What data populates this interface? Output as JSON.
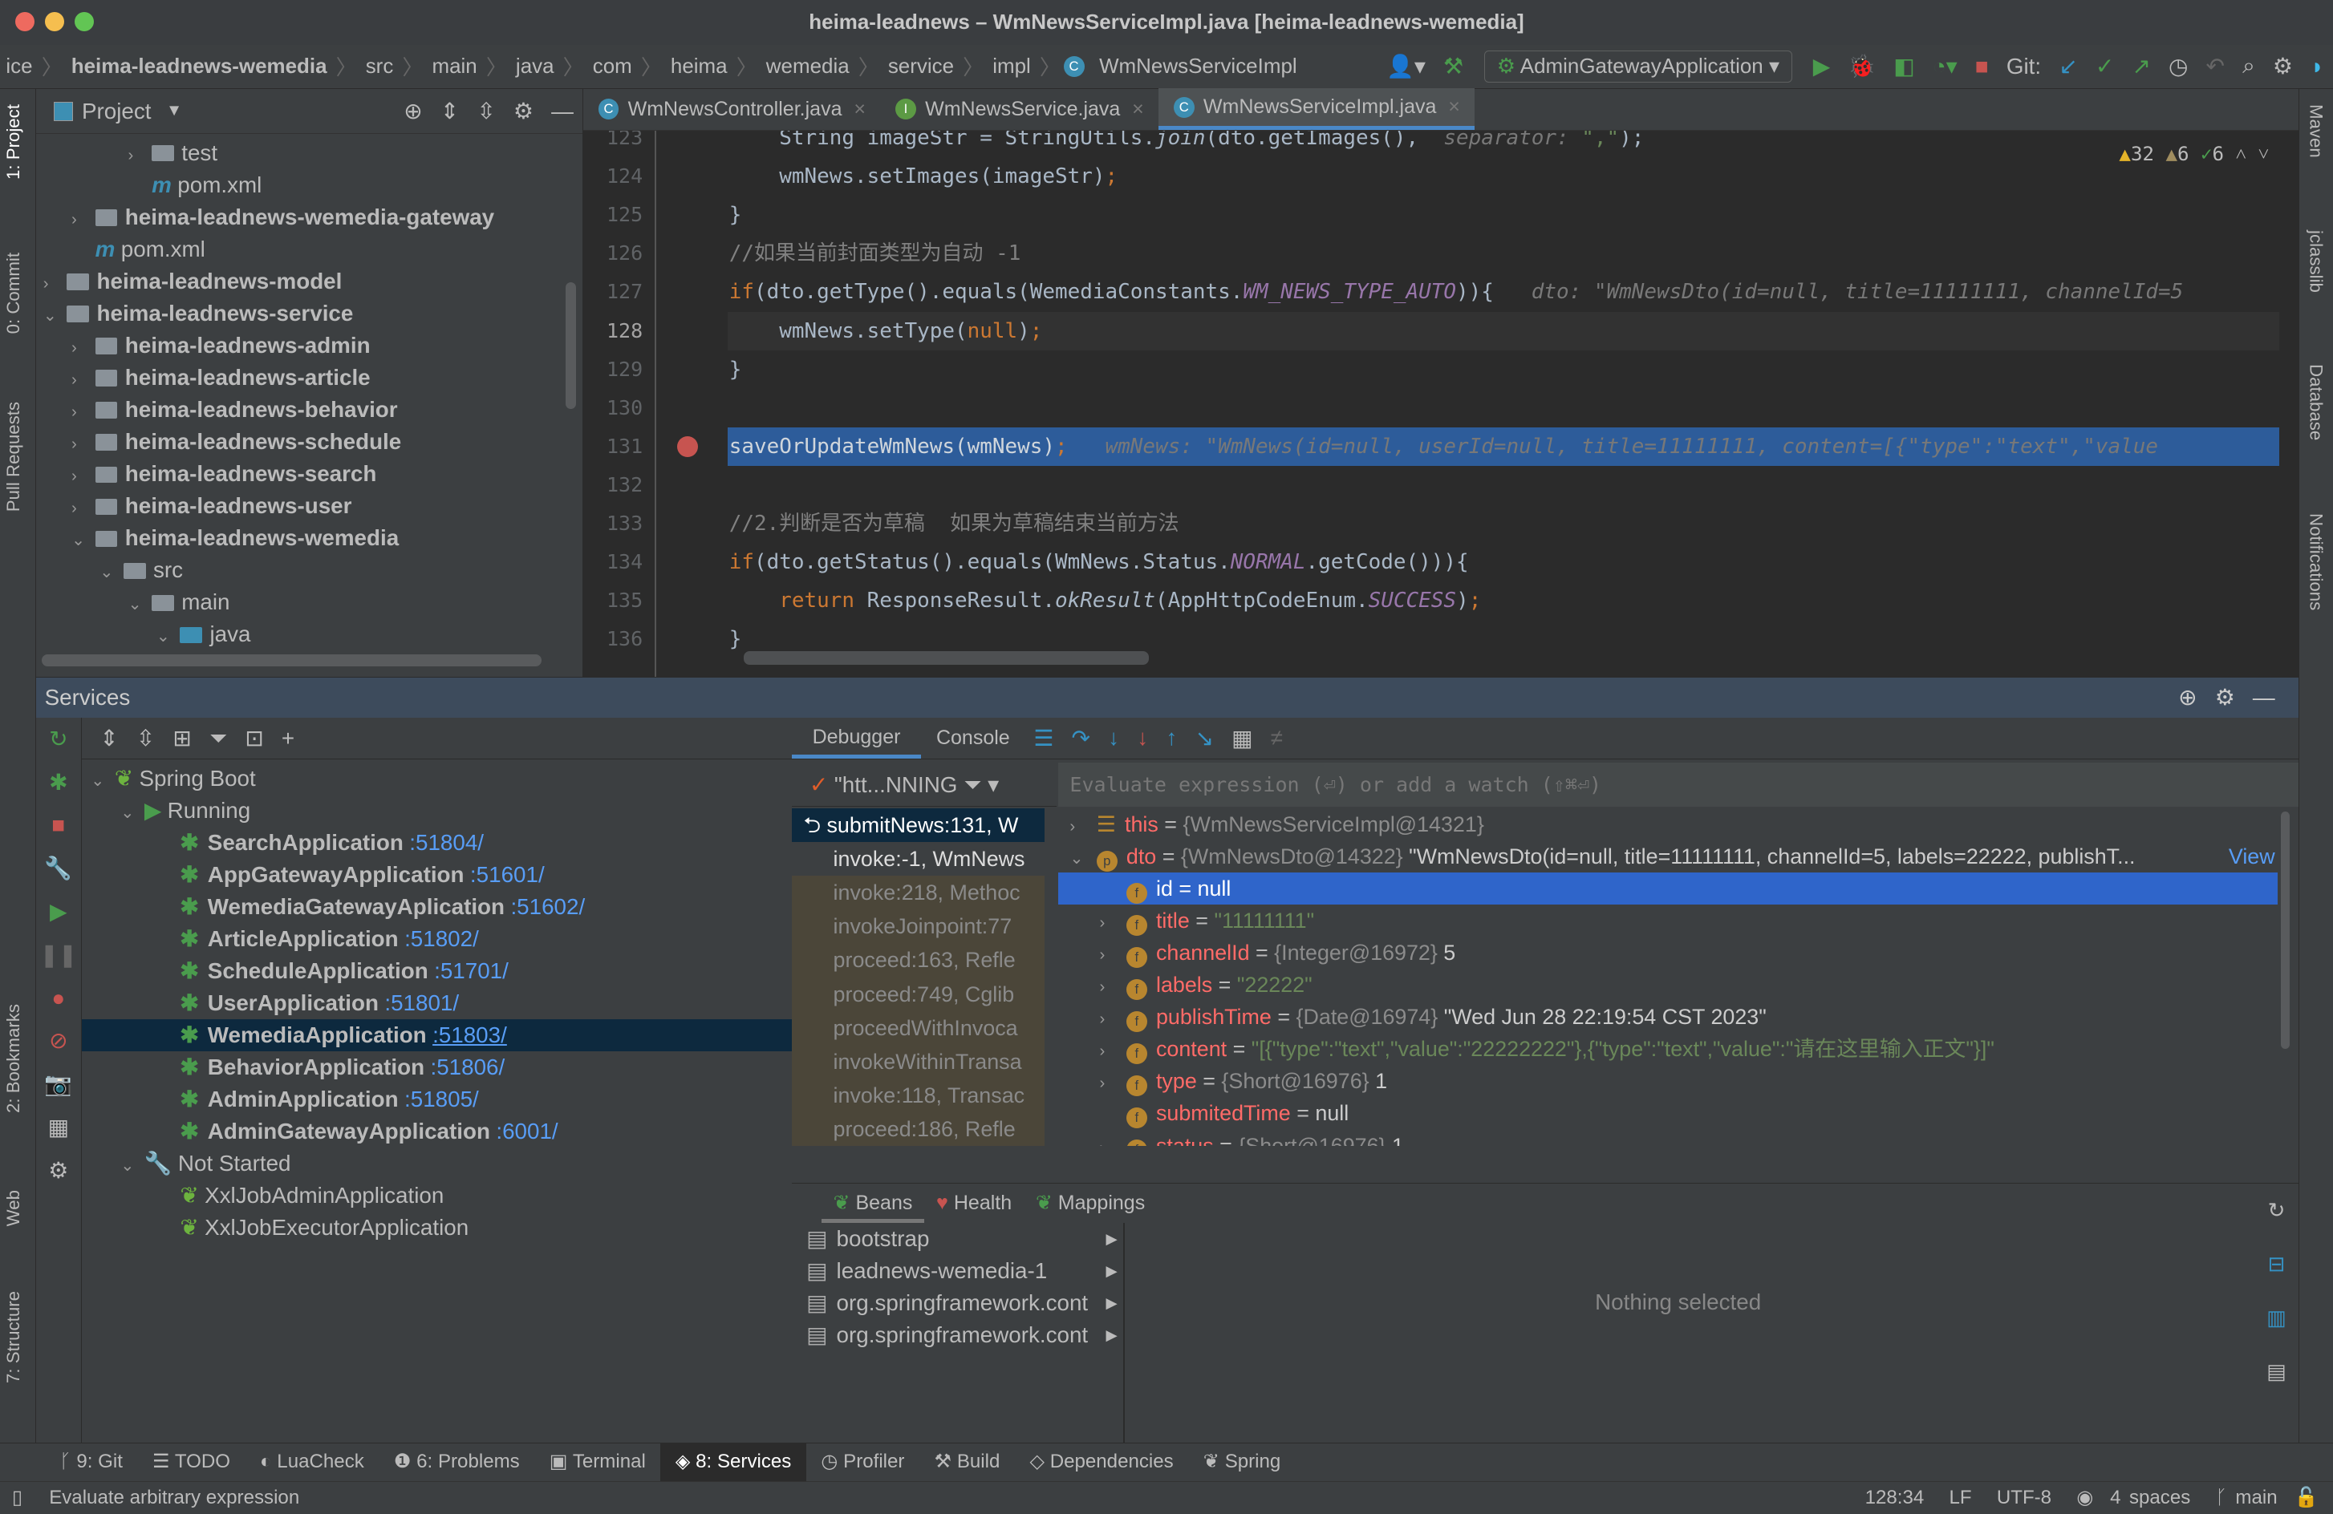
{
  "window": {
    "title": "heima-leadnews – WmNewsServiceImpl.java [heima-leadnews-wemedia]"
  },
  "breadcrumb": [
    "ice",
    "heima-leadnews-wemedia",
    "src",
    "main",
    "java",
    "com",
    "heima",
    "wemedia",
    "service",
    "impl",
    "WmNewsServiceImpl"
  ],
  "toolbar": {
    "run_config": "AdminGatewayApplication",
    "git_label": "Git:"
  },
  "left_stripe": [
    "1: Project",
    "0: Commit",
    "Pull Requests",
    "2: Bookmarks",
    "Web",
    "7: Structure"
  ],
  "right_stripe": [
    "Maven",
    "jclasslib",
    "Database",
    "Notifications"
  ],
  "project": {
    "title": "Project",
    "items": [
      {
        "label": "test",
        "depth": 4,
        "type": "folder",
        "chev": ">"
      },
      {
        "label": "pom.xml",
        "depth": 4,
        "type": "maven",
        "chev": ""
      },
      {
        "label": "heima-leadnews-wemedia-gateway",
        "depth": 2,
        "type": "module",
        "chev": ">"
      },
      {
        "label": "pom.xml",
        "depth": 2,
        "type": "maven",
        "chev": ""
      },
      {
        "label": "heima-leadnews-model",
        "depth": 1,
        "type": "module",
        "chev": ">"
      },
      {
        "label": "heima-leadnews-service",
        "depth": 1,
        "type": "module",
        "chev": "v"
      },
      {
        "label": "heima-leadnews-admin",
        "depth": 2,
        "type": "module",
        "chev": ">"
      },
      {
        "label": "heima-leadnews-article",
        "depth": 2,
        "type": "module",
        "chev": ">"
      },
      {
        "label": "heima-leadnews-behavior",
        "depth": 2,
        "type": "module",
        "chev": ">"
      },
      {
        "label": "heima-leadnews-schedule",
        "depth": 2,
        "type": "module",
        "chev": ">"
      },
      {
        "label": "heima-leadnews-search",
        "depth": 2,
        "type": "module",
        "chev": ">"
      },
      {
        "label": "heima-leadnews-user",
        "depth": 2,
        "type": "module",
        "chev": ">"
      },
      {
        "label": "heima-leadnews-wemedia",
        "depth": 2,
        "type": "module",
        "chev": "v"
      },
      {
        "label": "src",
        "depth": 3,
        "type": "folder",
        "chev": "v"
      },
      {
        "label": "main",
        "depth": 4,
        "type": "folder",
        "chev": "v"
      },
      {
        "label": "java",
        "depth": 5,
        "type": "srcfolder",
        "chev": "v"
      }
    ]
  },
  "editor": {
    "tabs": [
      {
        "label": "WmNewsController.java",
        "icon": "C",
        "color": "#3d8fb3"
      },
      {
        "label": "WmNewsService.java",
        "icon": "I",
        "color": "#5c9a44"
      },
      {
        "label": "WmNewsServiceImpl.java",
        "icon": "C",
        "color": "#3d8fb3",
        "active": true
      }
    ],
    "inspections": {
      "warnings": "32",
      "weak_warnings": "6",
      "typos": "6"
    },
    "current_line": 128,
    "breakpoint_line": 131,
    "lines": [
      {
        "n": "123",
        "segs": [
          [
            "    String imageStr = StringUtils.",
            ""
          ],
          [
            "join",
            "it"
          ],
          [
            "(dto.getImages(), ",
            ""
          ],
          [
            " separator: ",
            "hint"
          ],
          [
            "\",\"",
            "st"
          ],
          [
            ");",
            ""
          ]
        ]
      },
      {
        "n": "124",
        "segs": [
          [
            "    wmNews.setImages(imageStr)",
            ""
          ],
          [
            ";",
            "kw"
          ]
        ]
      },
      {
        "n": "125",
        "segs": [
          [
            "}",
            ""
          ]
        ]
      },
      {
        "n": "126",
        "segs": [
          [
            "//如果当前封面类型为自动 -1",
            "cm"
          ]
        ]
      },
      {
        "n": "127",
        "segs": [
          [
            "if",
            "kw"
          ],
          [
            "(dto.getType().equals(WemediaConstants.",
            ""
          ],
          [
            "WM_NEWS_TYPE_AUTO",
            "pu"
          ],
          [
            ")){   ",
            ""
          ],
          [
            "dto: \"WmNewsDto(id=null, title=11111111, channelId=5",
            "hint"
          ]
        ]
      },
      {
        "n": "128",
        "segs": [
          [
            "    wmNews.setType(",
            ""
          ],
          [
            "null",
            "kw"
          ],
          [
            ")",
            ""
          ],
          [
            ";",
            "kw"
          ]
        ]
      },
      {
        "n": "129",
        "segs": [
          [
            "}",
            ""
          ]
        ]
      },
      {
        "n": "130",
        "segs": []
      },
      {
        "n": "131",
        "segs": [
          [
            "saveOrUpdateWmNews(wmNews)",
            ""
          ],
          [
            ";",
            "kw"
          ],
          [
            "   wmNews: \"WmNews(id=null, userId=null, title=11111111, content=[{\"type\":\"text\",\"value",
            "hint"
          ]
        ]
      },
      {
        "n": "132",
        "segs": []
      },
      {
        "n": "133",
        "segs": [
          [
            "//2.判断是否为草稿  如果为草稿结束当前方法",
            "cm"
          ]
        ]
      },
      {
        "n": "134",
        "segs": [
          [
            "if",
            "kw"
          ],
          [
            "(dto.getStatus().equals(WmNews.Status.",
            ""
          ],
          [
            "NORMAL",
            "pu"
          ],
          [
            ".getCode())){",
            ""
          ]
        ]
      },
      {
        "n": "135",
        "segs": [
          [
            "    ",
            ""
          ],
          [
            "return ",
            "kw"
          ],
          [
            "ResponseResult.",
            ""
          ],
          [
            "okResult",
            "it"
          ],
          [
            "(AppHttpCodeEnum.",
            ""
          ],
          [
            "SUCCESS",
            "pu"
          ],
          [
            ")",
            ""
          ],
          [
            ";",
            "kw"
          ]
        ]
      },
      {
        "n": "136",
        "segs": [
          [
            "}",
            ""
          ]
        ]
      }
    ]
  },
  "services": {
    "title": "Services",
    "root": "Spring Boot",
    "running_label": "Running",
    "not_started_label": "Not Started",
    "running": [
      {
        "name": "SearchApplication",
        "port": ":51804/"
      },
      {
        "name": "AppGatewayApplication",
        "port": ":51601/"
      },
      {
        "name": "WemediaGatewayAplication",
        "port": ":51602/"
      },
      {
        "name": "ArticleApplication",
        "port": ":51802/"
      },
      {
        "name": "ScheduleApplication",
        "port": ":51701/"
      },
      {
        "name": "UserApplication",
        "port": ":51801/"
      },
      {
        "name": "WemediaApplication",
        "port": ":51803/",
        "selected": true
      },
      {
        "name": "BehaviorApplication",
        "port": ":51806/"
      },
      {
        "name": "AdminApplication",
        "port": ":51805/"
      },
      {
        "name": "AdminGatewayApplication",
        "port": ":6001/"
      }
    ],
    "not_started": [
      "XxlJobAdminApplication",
      "XxlJobExecutorApplication"
    ]
  },
  "debugger": {
    "tabs": [
      "Debugger",
      "Console"
    ],
    "thread": "\"htt...NNING",
    "eval_placeholder": "Evaluate expression (⏎) or add a watch (⇧⌘⏎)",
    "frames": [
      "submitNews:131, W",
      "invoke:-1, WmNews",
      "invoke:218, Methoc",
      "invokeJoinpoint:77",
      "proceed:163, Refle",
      "proceed:749, Cglib",
      "proceedWithInvoca",
      "invokeWithinTransa",
      "invoke:118, Transac",
      "proceed:186, Refle"
    ],
    "variables": [
      {
        "chev": ">",
        "icon": "this",
        "name": "this",
        "eq": " = ",
        "type": "{WmNewsServiceImpl@14321}",
        "val": "",
        "depth": 0
      },
      {
        "chev": "v",
        "icon": "p",
        "name": "dto",
        "eq": " = ",
        "type": "{WmNewsDto@14322} ",
        "val": "\"WmNewsDto(id=null, title=11111111, channelId=5, labels=22222, publishT...",
        "link": "View",
        "depth": 0
      },
      {
        "chev": "",
        "icon": "f",
        "name": "id",
        "eq": " = ",
        "type": "",
        "val": "null",
        "depth": 1,
        "selected": true
      },
      {
        "chev": ">",
        "icon": "f",
        "name": "title",
        "eq": " = ",
        "type": "",
        "str": "\"11111111\"",
        "depth": 1
      },
      {
        "chev": ">",
        "icon": "f",
        "name": "channelId",
        "eq": " = ",
        "type": "{Integer@16972} ",
        "val": "5",
        "depth": 1
      },
      {
        "chev": ">",
        "icon": "f",
        "name": "labels",
        "eq": " = ",
        "type": "",
        "str": "\"22222\"",
        "depth": 1
      },
      {
        "chev": ">",
        "icon": "f",
        "name": "publishTime",
        "eq": " = ",
        "type": "{Date@16974} ",
        "val": "\"Wed Jun 28 22:19:54 CST 2023\"",
        "depth": 1
      },
      {
        "chev": ">",
        "icon": "f",
        "name": "content",
        "eq": " = ",
        "type": "",
        "str": "\"[{\"type\":\"text\",\"value\":\"22222222\"},{\"type\":\"text\",\"value\":\"请在这里输入正文\"}]\"",
        "depth": 1
      },
      {
        "chev": ">",
        "icon": "f",
        "name": "type",
        "eq": " = ",
        "type": "{Short@16976} ",
        "val": "1",
        "depth": 1
      },
      {
        "chev": "",
        "icon": "f",
        "name": "submitedTime",
        "eq": " = ",
        "type": "",
        "val": "null",
        "depth": 1
      },
      {
        "chev": ">",
        "icon": "f",
        "name": "status",
        "eq": " = ",
        "type": "{Short@16976} ",
        "val": "1",
        "depth": 1
      }
    ]
  },
  "beans": {
    "tabs": [
      "Beans",
      "Health",
      "Mappings"
    ],
    "items": [
      "bootstrap",
      "leadnews-wemedia-1",
      "org.springframework.cont",
      "org.springframework.cont"
    ],
    "empty": "Nothing selected"
  },
  "toolwindows": [
    {
      "label": "9: Git"
    },
    {
      "label": "TODO"
    },
    {
      "label": "LuaCheck"
    },
    {
      "label": "6: Problems"
    },
    {
      "label": "Terminal"
    },
    {
      "label": "8: Services",
      "active": true
    },
    {
      "label": "Profiler"
    },
    {
      "label": "Build"
    },
    {
      "label": "Dependencies"
    },
    {
      "label": "Spring"
    }
  ],
  "status": {
    "message": "Evaluate arbitrary expression",
    "position": "128:34",
    "line_sep": "LF",
    "encoding": "UTF-8",
    "indent": "4 spaces",
    "branch": "main"
  }
}
